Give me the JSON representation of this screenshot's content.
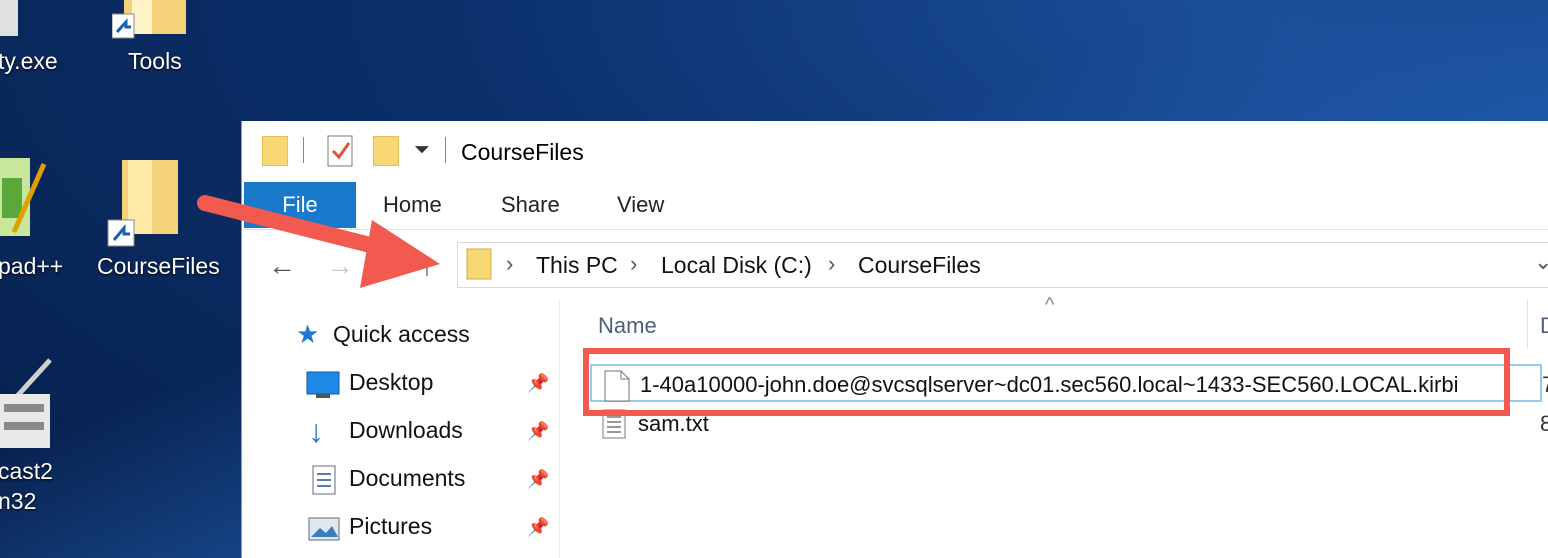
{
  "desktop": {
    "icons": [
      {
        "label": "ty.exe"
      },
      {
        "label": "Tools"
      },
      {
        "label": "pad++"
      },
      {
        "label": "CourseFiles"
      },
      {
        "label_line1": "cast2",
        "label_line2": "n32"
      }
    ]
  },
  "explorer": {
    "title": "CourseFiles",
    "ribbon_tabs": [
      "File",
      "Home",
      "Share",
      "View"
    ],
    "breadcrumb": [
      "This PC",
      "Local Disk (C:)",
      "CourseFiles"
    ],
    "nav": {
      "quick_access": "Quick access",
      "items": [
        "Desktop",
        "Downloads",
        "Documents",
        "Pictures"
      ]
    },
    "columns": {
      "name": "Name",
      "date_partial": "D"
    },
    "files": [
      {
        "name": "1-40a10000-john.doe@svcsqlserver~dc01.sec560.local~1433-SEC560.LOCAL.kirbi",
        "extra": "7"
      },
      {
        "name": "sam.txt",
        "extra": "8"
      }
    ]
  },
  "colors": {
    "accent": "#1979ca",
    "highlight": "#f25a4f",
    "folder": "#f8d775"
  }
}
